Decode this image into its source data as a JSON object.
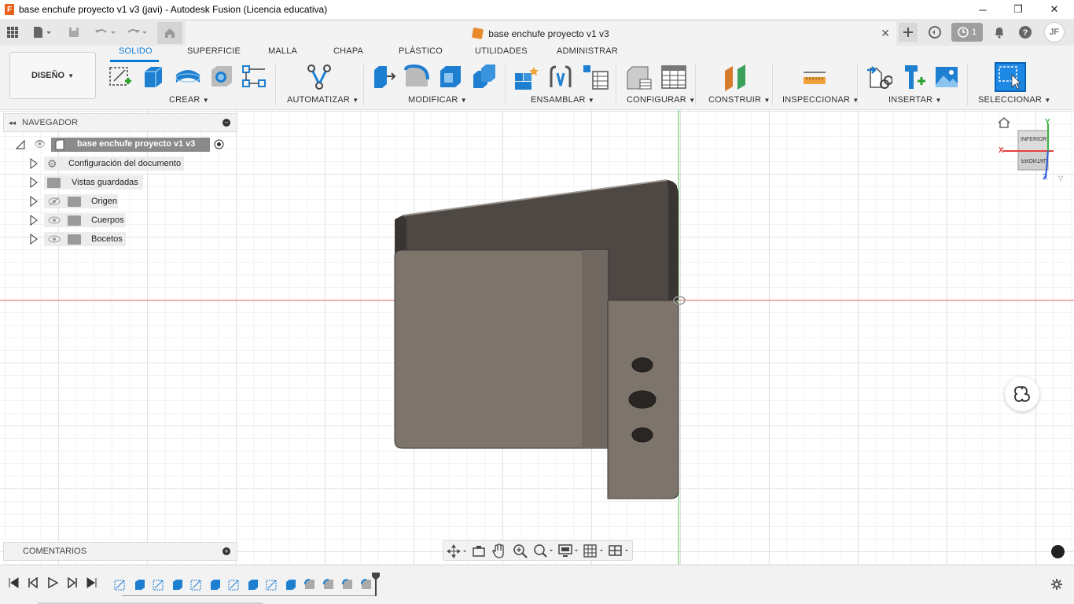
{
  "window": {
    "title": "base enchufe proyecto v1 v3 (javi) - Autodesk Fusion (Licencia educativa)",
    "app_icon_letter": "F",
    "minimize": "─",
    "maximize": "❐",
    "close": "✕"
  },
  "doc_tab": {
    "title": "base enchufe proyecto v1 v3",
    "close": "✕"
  },
  "top_right": {
    "job_count": "1",
    "user_initials": "JF"
  },
  "workspace": {
    "label": "DISEÑO"
  },
  "ribbon_tabs": [
    {
      "label": "SOLIDO",
      "active": true
    },
    {
      "label": "SUPERFICIE",
      "active": false
    },
    {
      "label": "MALLA",
      "active": false
    },
    {
      "label": "CHAPA",
      "active": false
    },
    {
      "label": "PLÁSTICO",
      "active": false
    },
    {
      "label": "UTILIDADES",
      "active": false
    },
    {
      "label": "ADMINISTRAR",
      "active": false
    }
  ],
  "ribbon_groups": [
    "CREAR",
    "AUTOMATIZAR",
    "MODIFICAR",
    "ENSAMBLAR",
    "CONFIGURAR",
    "CONSTRUIR",
    "INSPECCIONAR",
    "INSERTAR",
    "SELECCIONAR"
  ],
  "navigator": {
    "title": "NAVEGADOR",
    "root": "base enchufe proyecto v1 v3",
    "items": [
      {
        "label": "Configuración del documento",
        "icon": "gear-icon"
      },
      {
        "label": "Vistas guardadas",
        "icon": "folder-icon"
      },
      {
        "label": "Origen",
        "icon": "folder-icon",
        "visible": false
      },
      {
        "label": "Cuerpos",
        "icon": "folder-icon",
        "visible": true
      },
      {
        "label": "Bocetos",
        "icon": "folder-icon",
        "visible": true
      }
    ]
  },
  "comments": {
    "label": "COMENTARIOS"
  },
  "viewcube": {
    "top_face": "INFERIOR",
    "front_face": "FRONTAL",
    "axis_x": "X",
    "axis_y": "Y",
    "axis_z": "Z"
  },
  "colors": {
    "accent": "#0a7bd4",
    "model_body": "#7b7269",
    "model_top": "#4a4541",
    "axis_red": "#d9534f",
    "axis_green": "#3cb043"
  }
}
